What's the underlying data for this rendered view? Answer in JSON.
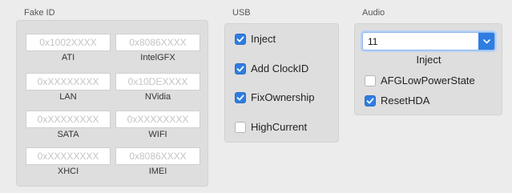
{
  "fake_id": {
    "title": "Fake ID",
    "fields": [
      {
        "placeholder": "0x1002XXXX",
        "label": "ATI"
      },
      {
        "placeholder": "0x8086XXXX",
        "label": "IntelGFX"
      },
      {
        "placeholder": "0xXXXXXXXX",
        "label": "LAN"
      },
      {
        "placeholder": "0x10DEXXXX",
        "label": "NVidia"
      },
      {
        "placeholder": "0xXXXXXXXX",
        "label": "SATA"
      },
      {
        "placeholder": "0xXXXXXXXX",
        "label": "WIFI"
      },
      {
        "placeholder": "0xXXXXXXXX",
        "label": "XHCI"
      },
      {
        "placeholder": "0x8086XXXX",
        "label": "IMEI"
      }
    ]
  },
  "usb": {
    "title": "USB",
    "options": [
      {
        "label": "Inject",
        "checked": true
      },
      {
        "label": "Add ClockID",
        "checked": true
      },
      {
        "label": "FixOwnership",
        "checked": true
      },
      {
        "label": "HighCurrent",
        "checked": false
      }
    ]
  },
  "audio": {
    "title": "Audio",
    "inject_value": "11",
    "inject_label": "Inject",
    "options": [
      {
        "label": "AFGLowPowerState",
        "checked": false
      },
      {
        "label": "ResetHDA",
        "checked": true
      }
    ]
  },
  "colors": {
    "accent": "#2f7de1",
    "panel": "#dedede",
    "background": "#ececec"
  }
}
